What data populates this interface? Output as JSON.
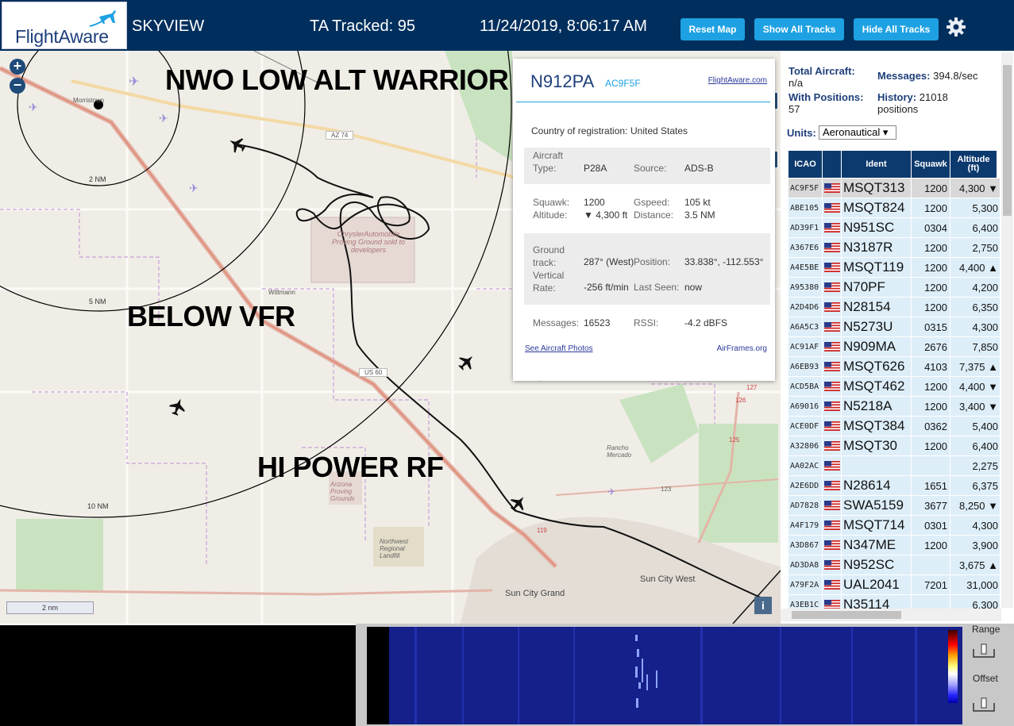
{
  "header": {
    "logo": "FlightAware",
    "app_name": "SKYVIEW",
    "ta_tracked": "TA Tracked: 95",
    "datetime": "11/24/2019, 8:06:17 AM",
    "buttons": {
      "reset": "Reset Map",
      "show": "Show All Tracks",
      "hide": "Hide All Tracks"
    }
  },
  "map": {
    "overlay_labels": [
      "NWO LOW ALT WARRIOR",
      "BELOW VFR",
      "HI POWER RF"
    ],
    "range_rings": [
      "2 NM",
      "5 NM",
      "10 NM"
    ],
    "places": [
      "Morristown",
      "Wittmann",
      "Sun City Grand",
      "Sun City West",
      "Rancho Mercado",
      "Arizona Proving Grounds",
      "Northwest Regional Landfill",
      "ChryslerAutomobile Proving Ground sold to developers"
    ],
    "highways": [
      "AZ 74",
      "US 60",
      "123",
      "119",
      "127",
      "126",
      "125"
    ],
    "scale": "2 nm",
    "zoom_in": "+",
    "zoom_out": "−",
    "info": "i"
  },
  "popup": {
    "registration": "N912PA",
    "hex": "AC9F5F",
    "fa_link": "FlightAware.com",
    "country_label": "Country of registration:",
    "country": "United States",
    "aircraft_type_label": "Aircraft Type:",
    "aircraft_type": "P28A",
    "source_label": "Source:",
    "source": "ADS-B",
    "squawk_label": "Squawk:",
    "squawk": "1200",
    "gspeed_label": "Gspeed:",
    "gspeed": "105 kt",
    "altitude_label": "Altitude:",
    "altitude": "▼ 4,300 ft",
    "distance_label": "Distance:",
    "distance": "3.5 NM",
    "ground_track_label": "Ground track:",
    "ground_track": "287° (West)",
    "position_label": "Position:",
    "position": "33.838°, -112.553°",
    "vrate_label": "Vertical Rate:",
    "vrate": "-256 ft/min",
    "last_seen_label": "Last Seen:",
    "last_seen": "now",
    "messages_label": "Messages:",
    "messages": "16523",
    "rssi_label": "RSSI:",
    "rssi": "-4.2 dBFS",
    "photos_link": "See Aircraft Photos",
    "airframes": "AirFrames.org"
  },
  "sidebar": {
    "total_label": "Total Aircraft:",
    "total_value": "n/a",
    "messages_label": "Messages:",
    "messages_value": "394.8/sec",
    "with_pos_label": "With Positions:",
    "with_pos_value": "57",
    "history_label": "History:",
    "history_value": "21018",
    "history_unit": "positions",
    "units_label": "Units:",
    "units_value": "Aeronautical ▾",
    "columns": [
      "ICAO",
      "",
      "Ident",
      "Squawk",
      "Altitude (ft)"
    ],
    "rows": [
      {
        "icao": "AC9F5F",
        "ident": "MSQT313",
        "squawk": "1200",
        "alt": "4,300 ▼"
      },
      {
        "icao": "ABE105",
        "ident": "MSQT824",
        "squawk": "1200",
        "alt": "5,300"
      },
      {
        "icao": "AD39F1",
        "ident": "N951SC",
        "squawk": "0304",
        "alt": "6,400"
      },
      {
        "icao": "A367E6",
        "ident": "N3187R",
        "squawk": "1200",
        "alt": "2,750"
      },
      {
        "icao": "A4E5BE",
        "ident": "MSQT119",
        "squawk": "1200",
        "alt": "4,400 ▲"
      },
      {
        "icao": "A95380",
        "ident": "N70PF",
        "squawk": "1200",
        "alt": "4,200"
      },
      {
        "icao": "A2D4D6",
        "ident": "N28154",
        "squawk": "1200",
        "alt": "6,350"
      },
      {
        "icao": "A6A5C3",
        "ident": "N5273U",
        "squawk": "0315",
        "alt": "4,300"
      },
      {
        "icao": "AC91AF",
        "ident": "N909MA",
        "squawk": "2676",
        "alt": "7,850"
      },
      {
        "icao": "A6EB93",
        "ident": "MSQT626",
        "squawk": "4103",
        "alt": "7,375 ▲"
      },
      {
        "icao": "ACD5BA",
        "ident": "MSQT462",
        "squawk": "1200",
        "alt": "4,400 ▼"
      },
      {
        "icao": "A69016",
        "ident": "N5218A",
        "squawk": "1200",
        "alt": "3,400 ▼"
      },
      {
        "icao": "ACE0DF",
        "ident": "MSQT384",
        "squawk": "0362",
        "alt": "5,400"
      },
      {
        "icao": "A32806",
        "ident": "MSQT30",
        "squawk": "1200",
        "alt": "6,400"
      },
      {
        "icao": "AA02AC",
        "ident": "",
        "squawk": "",
        "alt": "2,275"
      },
      {
        "icao": "A2E6DD",
        "ident": "N28614",
        "squawk": "1651",
        "alt": "6,375"
      },
      {
        "icao": "AD7828",
        "ident": "SWA5159",
        "squawk": "3677",
        "alt": "8,250 ▼"
      },
      {
        "icao": "A4F179",
        "ident": "MSQT714",
        "squawk": "0301",
        "alt": "4,300"
      },
      {
        "icao": "A3D867",
        "ident": "N347ME",
        "squawk": "1200",
        "alt": "3,900"
      },
      {
        "icao": "AD3DA8",
        "ident": "N952SC",
        "squawk": "",
        "alt": "3,675 ▲"
      },
      {
        "icao": "A79F2A",
        "ident": "UAL2041",
        "squawk": "7201",
        "alt": "31,000"
      },
      {
        "icao": "A3EB1C",
        "ident": "N35114",
        "squawk": "",
        "alt": "6,300"
      }
    ]
  },
  "waterfall": {
    "range_label": "Range",
    "offset_label": "Offset"
  }
}
